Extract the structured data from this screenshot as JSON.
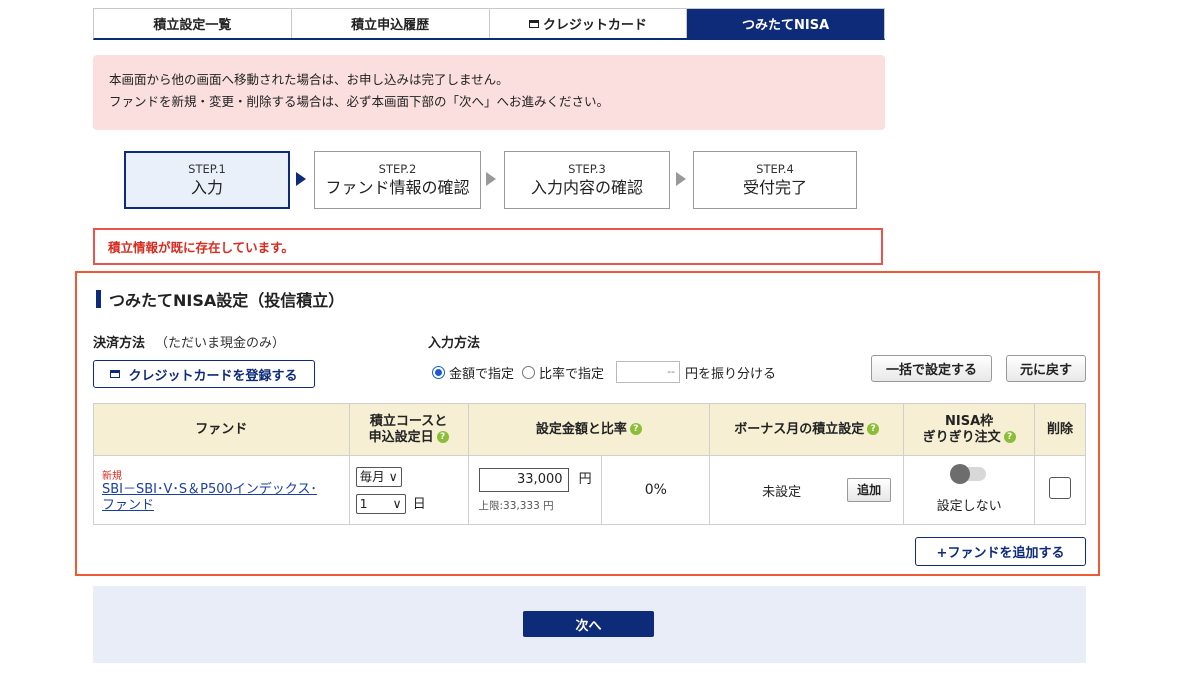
{
  "tabs": [
    "積立設定一覧",
    "積立申込履歴",
    "クレジットカード",
    "つみたてNISA"
  ],
  "notice": {
    "line1": "本画面から他の画面へ移動された場合は、お申し込みは完了しません。",
    "line2": "ファンドを新規・変更・削除する場合は、必ず本画面下部の「次へ」へお進みください。"
  },
  "steps": [
    {
      "num": "STEP.1",
      "label": "入力"
    },
    {
      "num": "STEP.2",
      "label": "ファンド情報の確認"
    },
    {
      "num": "STEP.3",
      "label": "入力内容の確認"
    },
    {
      "num": "STEP.4",
      "label": "受付完了"
    }
  ],
  "error": "積立情報が既に存在しています。",
  "section_title": "つみたてNISA設定（投信積立）",
  "payment": {
    "label": "決済方法",
    "note": "（ただいま現金のみ）",
    "register_card": "クレジットカードを登録する"
  },
  "input_method": {
    "label": "入力方法",
    "option_amount": "金額で指定",
    "option_ratio": "比率で指定",
    "amount_placeholder": "--",
    "suffix": "円を振り分ける",
    "bulk_button": "一括で設定する",
    "reset_button": "元に戻す"
  },
  "table": {
    "headers": {
      "fund": "ファンド",
      "course_line1": "積立コースと",
      "course_line2": "申込設定日",
      "amount": "設定金額と比率",
      "bonus": "ボーナス月の積立設定",
      "nisa_line1": "NISA枠",
      "nisa_line2": "ぎりぎり注文",
      "delete": "削除"
    },
    "row": {
      "tag": "新規",
      "fund_name_line1": "SBI－SBI･V･S＆P500インデックス･",
      "fund_name_line2": "ファンド",
      "course": "毎月",
      "day": "1",
      "day_unit": "日",
      "amount": "33,000",
      "yen": "円",
      "limit": "上限:33,333 円",
      "ratio": "0%",
      "bonus_status": "未設定",
      "bonus_add": "追加",
      "nisa_status": "設定しない"
    }
  },
  "add_fund": "+ファンドを追加する",
  "next": "次へ"
}
